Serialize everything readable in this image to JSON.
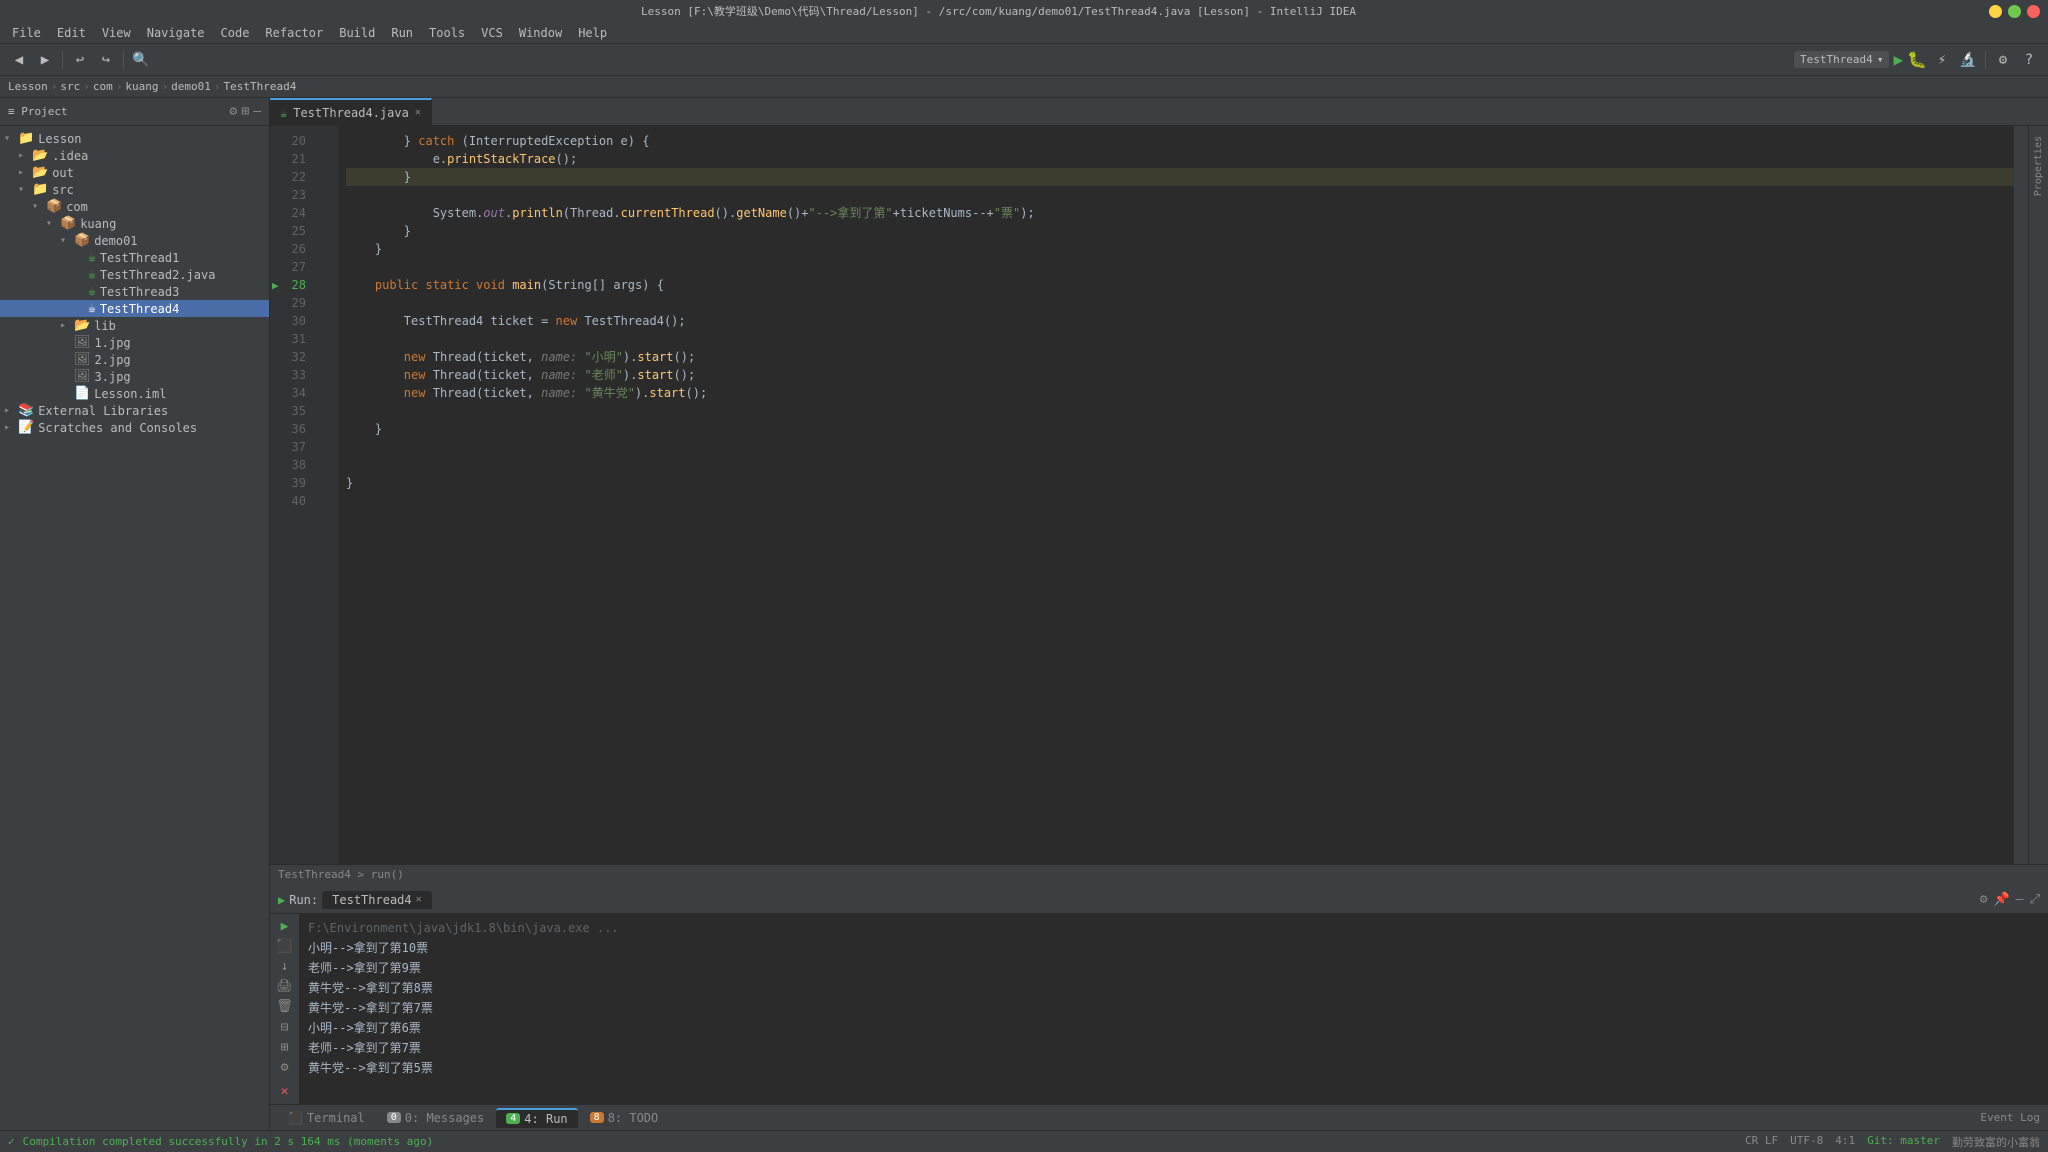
{
  "window": {
    "title": "Lesson [F:\\教学班级\\Demo\\代码\\Thread/Lesson] - /src/com/kuang/demo01/TestThread4.java [Lesson] - IntelliJ IDEA"
  },
  "menu": {
    "items": [
      "File",
      "Edit",
      "View",
      "Navigate",
      "Code",
      "Refactor",
      "Build",
      "Run",
      "Tools",
      "VCS",
      "Window",
      "Help"
    ]
  },
  "toolbar": {
    "run_config": "TestThread4"
  },
  "breadcrumb": {
    "items": [
      "Lesson",
      "src",
      "com",
      "kuang",
      "demo01",
      "TestThread4"
    ]
  },
  "project_panel": {
    "title": "Project",
    "tree": [
      {
        "id": "lesson",
        "label": "Lesson",
        "type": "project",
        "level": 0,
        "expanded": true
      },
      {
        "id": "idea",
        "label": ".idea",
        "type": "folder",
        "level": 1,
        "expanded": false
      },
      {
        "id": "out",
        "label": "out",
        "type": "folder",
        "level": 1,
        "expanded": false
      },
      {
        "id": "src",
        "label": "src",
        "type": "source",
        "level": 1,
        "expanded": true
      },
      {
        "id": "com",
        "label": "com",
        "type": "package",
        "level": 2,
        "expanded": true
      },
      {
        "id": "kuang",
        "label": "kuang",
        "type": "package",
        "level": 3,
        "expanded": true
      },
      {
        "id": "demo01",
        "label": "demo01",
        "type": "package",
        "level": 4,
        "expanded": true
      },
      {
        "id": "testthread1",
        "label": "TestThread1",
        "type": "java",
        "level": 5,
        "expanded": false
      },
      {
        "id": "testthread2java",
        "label": "TestThread2.java",
        "type": "java",
        "level": 5,
        "expanded": false
      },
      {
        "id": "testthread3",
        "label": "TestThread3",
        "type": "java_class",
        "level": 5,
        "expanded": false
      },
      {
        "id": "testthread4",
        "label": "TestThread4",
        "type": "java_active",
        "level": 5,
        "expanded": false,
        "selected": true
      },
      {
        "id": "lib",
        "label": "lib",
        "type": "folder",
        "level": 4,
        "expanded": false
      },
      {
        "id": "img1",
        "label": "1.jpg",
        "type": "image",
        "level": 4
      },
      {
        "id": "img2",
        "label": "2.jpg",
        "type": "image",
        "level": 4
      },
      {
        "id": "img3",
        "label": "3.jpg",
        "type": "image",
        "level": 4
      },
      {
        "id": "lessonxml",
        "label": "Lesson.iml",
        "type": "module",
        "level": 4
      },
      {
        "id": "extlibs",
        "label": "External Libraries",
        "type": "folder",
        "level": 0,
        "expanded": false
      },
      {
        "id": "scratches",
        "label": "Scratches and Consoles",
        "type": "folder",
        "level": 0,
        "expanded": false
      }
    ]
  },
  "editor": {
    "tab": "TestThread4.java",
    "breadcrumb_bottom": "TestThread4 > run()",
    "lines": [
      {
        "num": 20,
        "content": "} catch (InterruptedException e) {",
        "highlighted": false,
        "tokens": [
          {
            "t": "kw",
            "v": "} catch"
          },
          {
            "t": "plain",
            "v": " (InterruptedException e) {"
          }
        ]
      },
      {
        "num": 21,
        "content": "    e.printStackTrace();",
        "highlighted": false,
        "tokens": [
          {
            "t": "plain",
            "v": "            e."
          },
          {
            "t": "method",
            "v": "printStackTrace"
          },
          {
            "t": "plain",
            "v": "();"
          }
        ]
      },
      {
        "num": 22,
        "content": "}",
        "highlighted": false,
        "tokens": [
          {
            "t": "plain",
            "v": "        }"
          }
        ]
      },
      {
        "num": 23,
        "content": "",
        "highlighted": false,
        "tokens": []
      },
      {
        "num": 24,
        "content": "System.out.println(Thread.currentThread().getName()+\"-->拿到了第\"+ticketNums--+\"票\");",
        "highlighted": false
      },
      {
        "num": 25,
        "content": "}",
        "highlighted": false
      },
      {
        "num": 26,
        "content": "}",
        "highlighted": false
      },
      {
        "num": 27,
        "content": "",
        "highlighted": false
      },
      {
        "num": 28,
        "content": "public static void main(String[] args) {",
        "highlighted": false,
        "has_run": true
      },
      {
        "num": 29,
        "content": "",
        "highlighted": false
      },
      {
        "num": 30,
        "content": "    TestThread4 ticket = new TestThread4();",
        "highlighted": false
      },
      {
        "num": 31,
        "content": "",
        "highlighted": false
      },
      {
        "num": 32,
        "content": "    new Thread(ticket, name: \"小明\").start();",
        "highlighted": false
      },
      {
        "num": 33,
        "content": "    new Thread(ticket, name: \"老师\").start();",
        "highlighted": false
      },
      {
        "num": 34,
        "content": "    new Thread(ticket, name: \"黄牛党\").start();",
        "highlighted": false
      },
      {
        "num": 35,
        "content": "",
        "highlighted": false
      },
      {
        "num": 36,
        "content": "}",
        "highlighted": false
      },
      {
        "num": 37,
        "content": "",
        "highlighted": false
      },
      {
        "num": 38,
        "content": "",
        "highlighted": false
      },
      {
        "num": 39,
        "content": "}",
        "highlighted": false
      },
      {
        "num": 40,
        "content": "",
        "highlighted": false
      }
    ]
  },
  "run_panel": {
    "tab": "TestThread4",
    "cmd_line": "F:\\Environment\\java\\jdk1.8\\bin\\java.exe ...",
    "output": [
      "小明-->拿到了第10票",
      "老师-->拿到了第9票",
      "黄牛党-->拿到了第8票",
      "黄牛党-->拿到了第7票",
      "小明-->拿到了第6票",
      "老师-->拿到了第7票",
      "黄牛党-->拿到了第5票"
    ]
  },
  "bottom_tabs": [
    {
      "label": "Terminal",
      "icon": ">_",
      "active": false
    },
    {
      "label": "0: Messages",
      "icon": "✉",
      "active": false,
      "badge": "0",
      "badge_color": "gray"
    },
    {
      "label": "4: Run",
      "icon": "▶",
      "active": true,
      "badge": "4",
      "badge_color": "green"
    },
    {
      "label": "8: TODO",
      "icon": "☑",
      "active": false,
      "badge": "8",
      "badge_color": "orange"
    }
  ],
  "status_bar": {
    "message": "Compilation completed successfully in 2 s 164 ms (moments ago)",
    "right_items": [
      "CR LF",
      "UTF-8",
      "4:1",
      "Git: master"
    ]
  },
  "side_tools": {
    "right": [
      "Properties"
    ]
  }
}
